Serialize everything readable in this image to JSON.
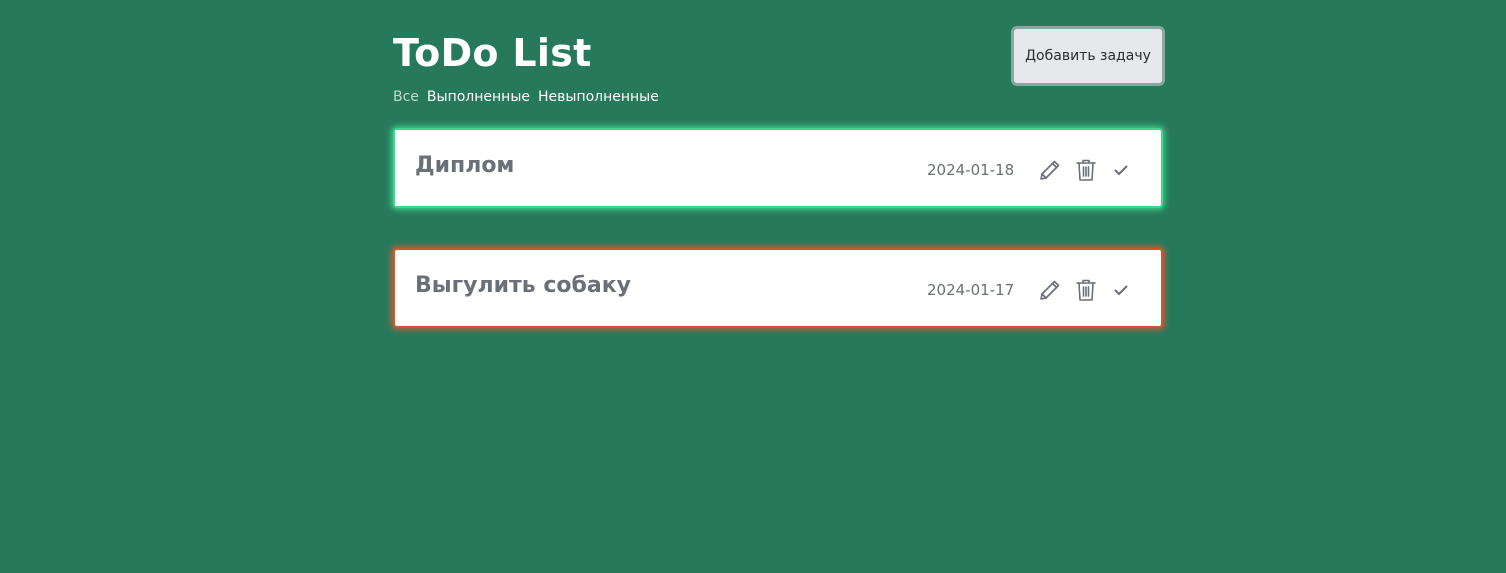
{
  "header": {
    "title": "ToDo List",
    "add_button_label": "Добавить задачу"
  },
  "filters": [
    {
      "label": "Все",
      "active": false
    },
    {
      "label": "Выполненные",
      "active": true
    },
    {
      "label": "Невыполненные",
      "active": true
    }
  ],
  "tasks": [
    {
      "title": "Диплом",
      "date": "2024-01-18",
      "status": "done",
      "status_color": "#3fd68f"
    },
    {
      "title": "Выгулить собаку",
      "date": "2024-01-17",
      "status": "pending",
      "status_color": "#d0552f"
    }
  ],
  "colors": {
    "background": "#27795c",
    "card": "#ffffff",
    "text_muted": "#6a6f78",
    "button_bg": "#e6e8ec"
  },
  "icons": {
    "edit": "pencil-icon",
    "delete": "trash-icon",
    "complete": "check-icon"
  }
}
